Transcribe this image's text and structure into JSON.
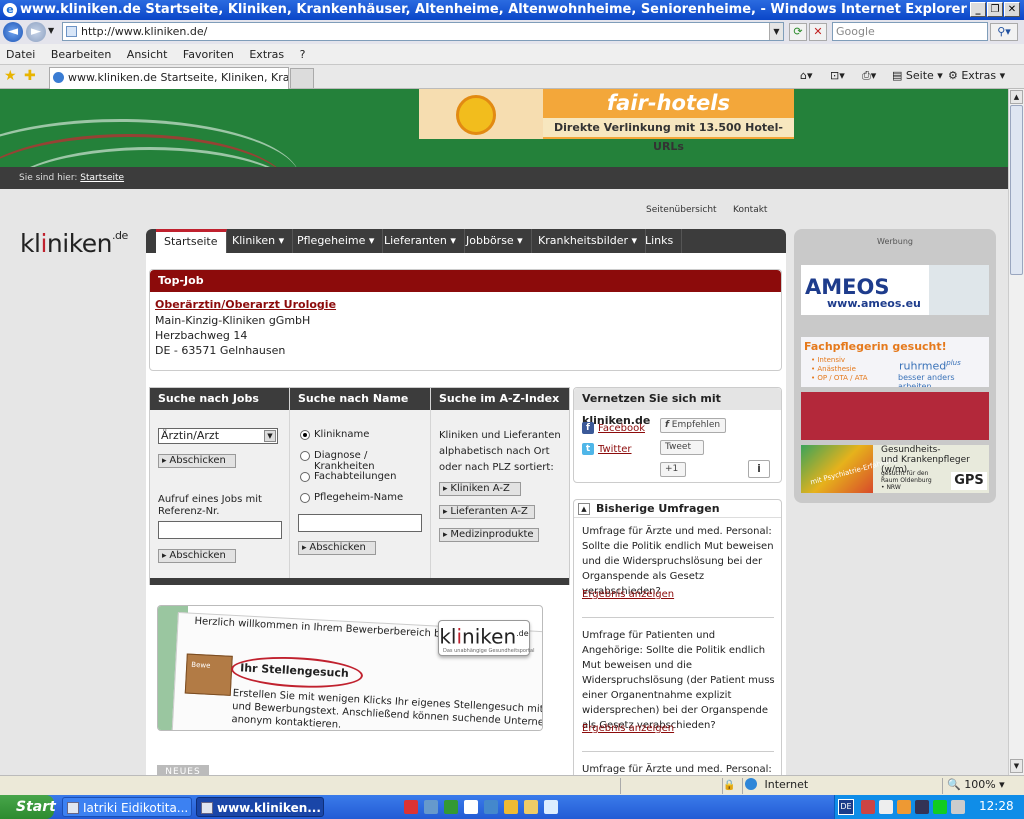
{
  "window": {
    "title": "www.kliniken.de Startseite, Kliniken, Krankenhäuser, Altenheime, Altenwohnheime, Seniorenheime, - Windows Internet Explorer"
  },
  "addressbar": {
    "url": "http://www.kliniken.de/",
    "search_placeholder": "Google"
  },
  "menu": [
    "Datei",
    "Bearbeiten",
    "Ansicht",
    "Favoriten",
    "Extras",
    "?"
  ],
  "tabs": {
    "active_label": "www.kliniken.de Startseite, Kliniken, Kranke..."
  },
  "commandbar": {
    "seite": "Seite",
    "extras": "Extras"
  },
  "banner": {
    "brand": "fair-hotels",
    "tagline": "Direkte Verlinkung mit 13.500 Hotel-URLs"
  },
  "breadcrumb": {
    "prefix": "Sie sind hier:",
    "link": "Startseite"
  },
  "toplinks": {
    "sitemap": "Seitenübersicht",
    "contact": "Kontakt"
  },
  "logo": {
    "part1": "kl",
    "part2": "i",
    "part3": "ni",
    "part4": "ken",
    "tld": ".de"
  },
  "nav": {
    "items": [
      "Startseite",
      "Kliniken ▾",
      "Pflegeheime ▾",
      "Lieferanten ▾",
      "Jobbörse ▾",
      "Krankheitsbilder ▾",
      "Links"
    ]
  },
  "topjob": {
    "header": "Top-Job",
    "title": "Oberärztin/Oberarzt Urologie",
    "employer": "Main-Kinzig-Kliniken gGmbH",
    "street": "Herzbachweg 14",
    "city": "DE - 63571 Gelnhausen"
  },
  "search": {
    "jobs": {
      "header": "Suche nach Jobs",
      "select_value": "Ärztin/Arzt",
      "submit": "Abschicken",
      "ref_label": "Aufruf eines Jobs mit Referenz-Nr.",
      "ref_submit": "Abschicken"
    },
    "name": {
      "header": "Suche nach Name",
      "options": [
        "Klinikname",
        "Diagnose / Krankheiten",
        "Fachabteilungen",
        "Pflegeheim-Name"
      ],
      "selected": "Klinikname",
      "submit": "Abschicken"
    },
    "az": {
      "header": "Suche im A-Z-Index",
      "description": "Kliniken und Lieferanten alphabetisch nach Ort oder nach PLZ sortiert:",
      "buttons": [
        "Kliniken A-Z",
        "Lieferanten A-Z",
        "Medizinprodukte"
      ]
    }
  },
  "social": {
    "header": "Vernetzen Sie sich mit kliniken.de",
    "facebook": "Facebook",
    "twitter": "Twitter",
    "recommend": "Empfehlen",
    "tweet": "Tweet",
    "plusone": "+1",
    "info": "i"
  },
  "polls": {
    "header": "Bisherige Umfragen",
    "items": [
      {
        "text": "Umfrage für Ärzte und med. Personal: Sollte die Politik endlich Mut beweisen und die Widerspruchslösung bei der Organspende als Gesetz verabschieden?",
        "link": "Ergebnis anzeigen"
      },
      {
        "text": "Umfrage für Patienten und Angehörige: Sollte die Politik endlich Mut beweisen und die Widerspruchslösung (der Patient muss einer Organentnahme explizit widersprechen) bei der Organspende als Gesetz verabschieden?",
        "link": "Ergebnis anzeigen"
      },
      {
        "text": "Umfrage für Ärzte und med. Personal:",
        "link": ""
      }
    ]
  },
  "promo": {
    "line1": "Herzlich willkommen in Ihrem Bewerberbereich be",
    "heading": "Ihr Stellengesuch",
    "tab_label": "Bewe",
    "line2": "Erstellen Sie mit wenigen Klicks Ihr eigenes Stellengesuch mit Le",
    "line3": "und Bewerbungstext. Anschließend können suchende Unterneh",
    "line4": "anonym kontaktieren.",
    "logo_sub": "Das unabhängige Gesundheitsportal",
    "logo_part1": "kl",
    "logo_part2": "i",
    "logo_part3": "ni",
    "logo_part4": "ken",
    "logo_tld": ".de"
  },
  "neues": "NEUES",
  "werbung": {
    "label": "Werbung",
    "ad1": {
      "brand": "AMEOS",
      "url": "www.ameos.eu"
    },
    "ad2": {
      "headline": "Fachpflegerin gesucht!",
      "bullets": [
        "• Intensiv",
        "• Anästhesie",
        "• OP / OTA / ATA"
      ],
      "brand": "ruhrmed",
      "brand_plus": "plus",
      "slogan": "besser anders arbeiten"
    },
    "ad4": {
      "title1": "Gesundheits-",
      "title2": "und Krankenpfleger (w/m)",
      "sub1": "gesucht für den",
      "sub2": "Raum Oldenburg",
      "sub3": "• NRW",
      "brand": "GPS",
      "overlay": "mit Psychiatrie-Erfahrung"
    }
  },
  "statusbar": {
    "zone": "Internet",
    "zoom": "100%"
  },
  "taskbar": {
    "start": "Start",
    "tasks": [
      "Iatriki Eidikotita...",
      "www.kliniken..."
    ],
    "lang": "DE",
    "clock": "12:28"
  },
  "colors": {
    "brand_red": "#8c0b0b",
    "header_green": "#24813a",
    "dark_bar": "#3c3c3c"
  }
}
